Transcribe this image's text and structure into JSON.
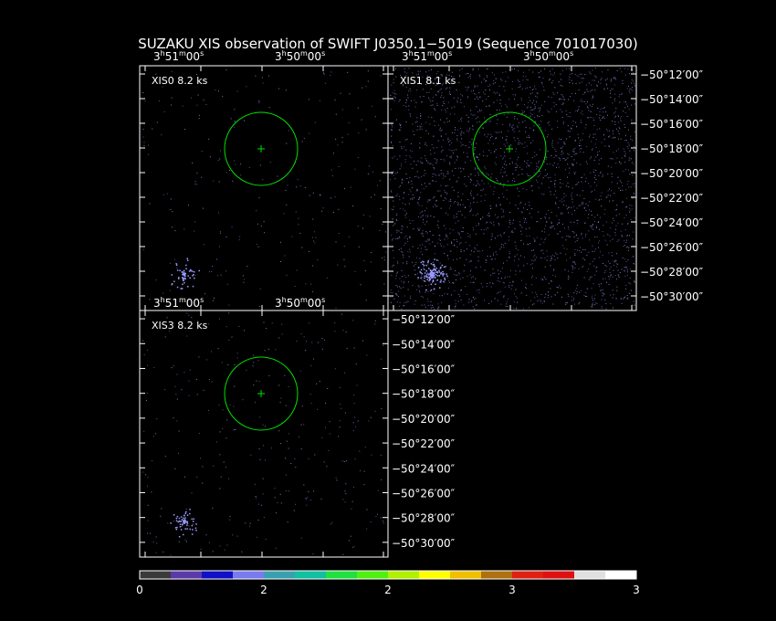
{
  "title": "SUZAKU XIS observation of SWIFT J0350.1−5019  (Sequence 701017030)",
  "panels": [
    {
      "id": "xis0",
      "label": "XIS0 8.2 ks",
      "ra_labels": [
        {
          "h": "3",
          "m": "51",
          "s": "00",
          "suffix": "s"
        },
        {
          "h": "3",
          "m": "50",
          "s": "00",
          "suffix": "s"
        }
      ],
      "dec_labels": []
    },
    {
      "id": "xis1",
      "label": "XIS1 8.1 ks",
      "ra_labels": [
        {
          "h": "3",
          "m": "51",
          "s": "00",
          "suffix": "s"
        },
        {
          "h": "3",
          "m": "50",
          "s": "00",
          "suffix": "s"
        }
      ],
      "dec_labels": [
        "−50°12′00″",
        "−50°14′00″",
        "−50°16′00″",
        "−50°18′00″",
        "−50°20′00″",
        "−50°22′00″",
        "−50°24′00″",
        "−50°26′00″",
        "−50°28′00″",
        "−50°30′00″"
      ]
    },
    {
      "id": "xis3",
      "label": "XIS3 8.2 ks",
      "ra_labels": [
        {
          "h": "3",
          "m": "51",
          "s": "00",
          "suffix": "s"
        },
        {
          "h": "3",
          "m": "50",
          "s": "00",
          "suffix": "s"
        }
      ],
      "dec_labels": [
        "−50°12′00″",
        "−50°14′00″",
        "−50°16′00″",
        "−50°18′00″",
        "−50°20′00″",
        "−50°22′00″",
        "−50°24′00″",
        "−50°26′00″",
        "−50°28′00″",
        "−50°30′00″"
      ]
    }
  ],
  "colorbar": {
    "colors": [
      "#3a3a3a",
      "#5a3aa8",
      "#1010c8",
      "#7a7af0",
      "#3aa0b0",
      "#10c0a0",
      "#20e040",
      "#50f010",
      "#b0f000",
      "#ffff00",
      "#f0c000",
      "#b07010",
      "#e02010",
      "#e01010",
      "#e0e0e0",
      "#ffffff"
    ],
    "tick_labels": [
      "0",
      "2",
      "2",
      "3",
      "3"
    ]
  },
  "colors": {
    "background": "#000000",
    "frame": "#ffffff",
    "source_region": "#00e000",
    "events": "#8080ff"
  }
}
